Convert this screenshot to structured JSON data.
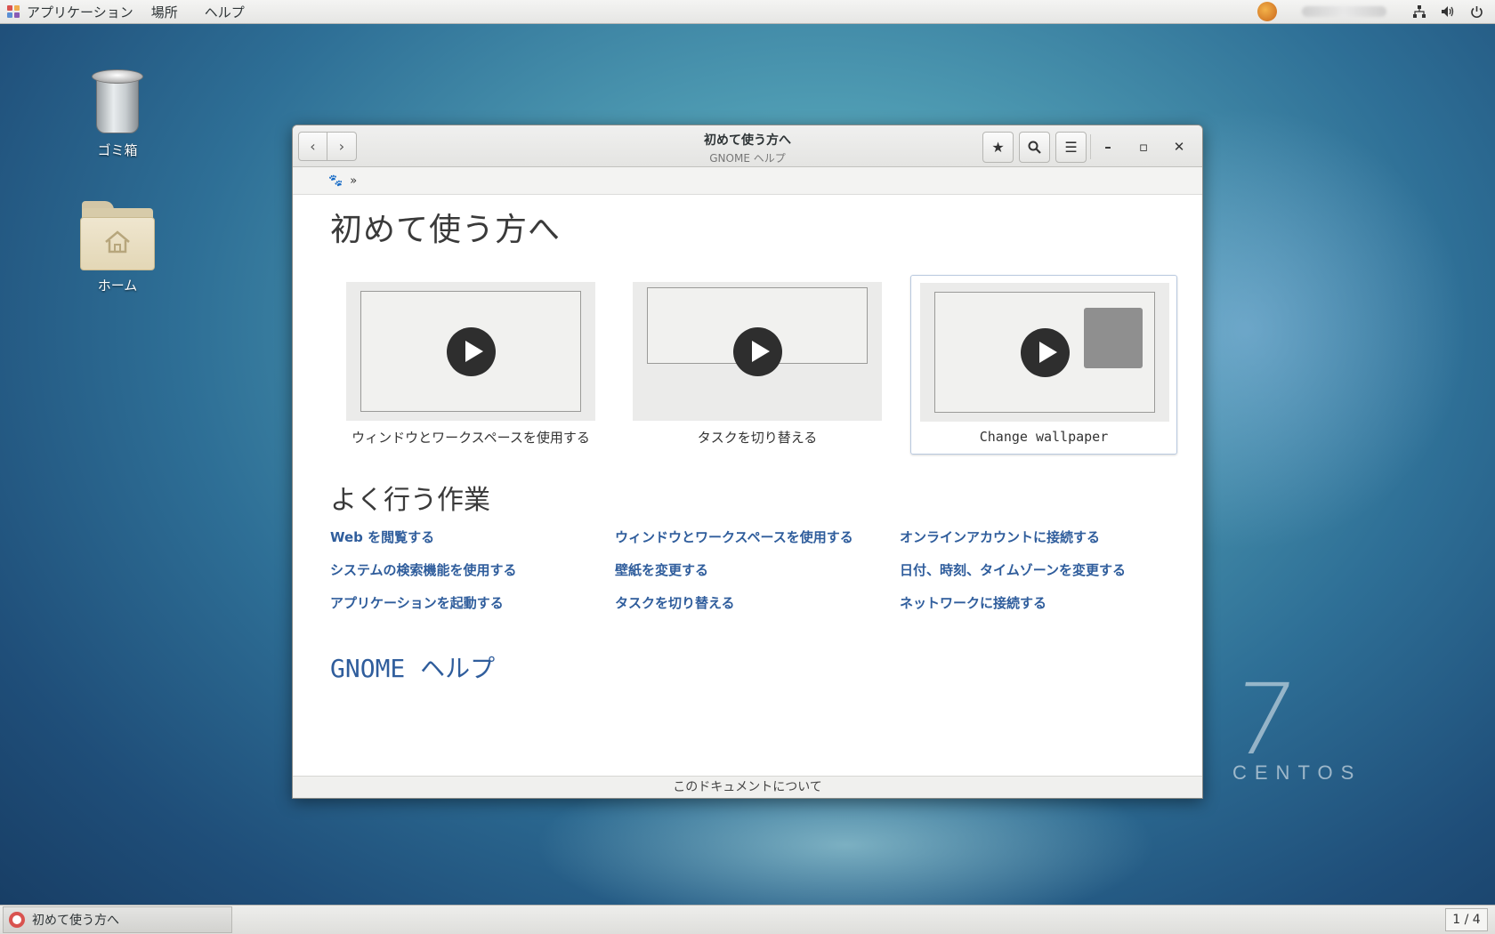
{
  "top_panel": {
    "menus": [
      "アプリケーション",
      "場所",
      "ヘルプ"
    ]
  },
  "desktop": {
    "icons": [
      {
        "label": "ゴミ箱",
        "icon": "trash-icon"
      },
      {
        "label": "ホーム",
        "icon": "home-folder-icon"
      }
    ],
    "brand_number": "7",
    "brand_word": "CENTOS"
  },
  "window": {
    "title": "初めて使う方へ",
    "subtitle": "GNOME ヘルプ",
    "breadcrumb_separator": "»",
    "heading": "初めて使う方へ",
    "videos": [
      {
        "label": "ウィンドウとワークスペースを使用する"
      },
      {
        "label": "タスクを切り替える"
      },
      {
        "label": "Change wallpaper"
      }
    ],
    "common_tasks_heading": "よく行う作業",
    "links": [
      "Web を閲覧する",
      "ウィンドウとワークスペースを使用する",
      "オンラインアカウントに接続する",
      "システムの検索機能を使用する",
      "壁紙を変更する",
      "日付、時刻、タイムゾーンを変更する",
      "アプリケーションを起動する",
      "タスクを切り替える",
      "ネットワークに接続する"
    ],
    "gnome_help_link": "GNOME ヘルプ",
    "footer": "このドキュメントについて"
  },
  "bottom_panel": {
    "task_label": "初めて使う方へ",
    "workspace": "1 / 4"
  },
  "colors": {
    "link": "#2f5d9c",
    "accent_selected_border": "#b9c9df"
  }
}
